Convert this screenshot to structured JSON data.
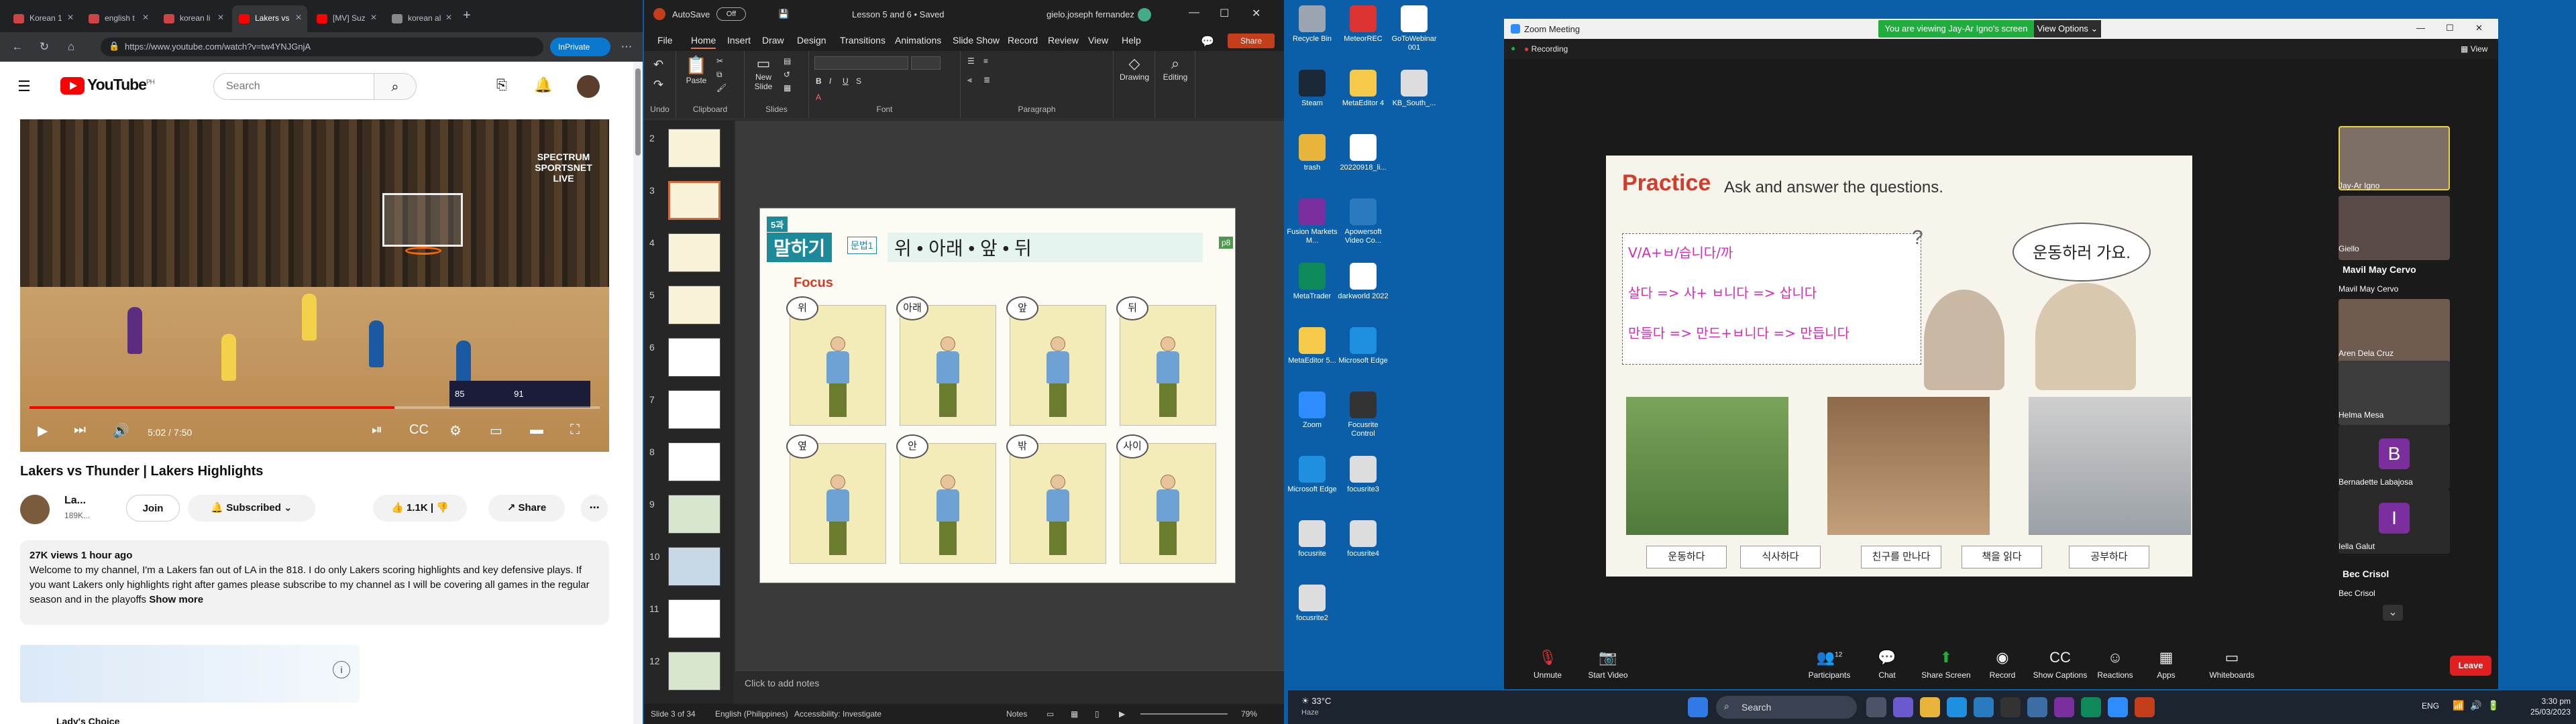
{
  "browser": {
    "tabs": [
      {
        "label": "Korean 1"
      },
      {
        "label": "english t"
      },
      {
        "label": "korean li"
      },
      {
        "label": "Lakers vs"
      },
      {
        "label": "[MV] Suz"
      },
      {
        "label": "korean al"
      }
    ],
    "url": "https://www.youtube.com/watch?v=tw4YNJGnjA",
    "inprivate": "InPrivate"
  },
  "youtube": {
    "logo": "YouTube",
    "region": "PH",
    "search_placeholder": "Search",
    "video": {
      "title": "Lakers vs Thunder | Lakers Highlights",
      "time": "5:02 / 7:50",
      "progress_percent": 64,
      "watermark": "SPECTRUM SPORTSNET LIVE",
      "score_left": "85",
      "score_right": "91"
    },
    "channel": {
      "name": "La...",
      "subs": "189K...",
      "join": "Join",
      "subscribed": "Subscribed",
      "likes": "1.1K",
      "share": "Share"
    },
    "description": {
      "meta": "27K views  1 hour ago",
      "text": "Welcome to my channel, I'm a Lakers fan out of LA in the 818. I do only Lakers scoring highlights and key defensive plays. If you want Lakers only highlights right after games please subscribe to my channel as I will be covering all games in the regular season and in the playoffs",
      "show_more": "Show more"
    },
    "ad_partial_title": "Lady's Choice"
  },
  "ppt": {
    "autosave": "AutoSave",
    "autosave_state": "Off",
    "doc_title": "Lesson 5 and 6 • Saved",
    "user": "gielo.joseph fernandez",
    "menu": [
      "File",
      "Home",
      "Insert",
      "Draw",
      "Design",
      "Transitions",
      "Animations",
      "Slide Show",
      "Record",
      "Review",
      "View",
      "Help"
    ],
    "share": "Share",
    "ribbon_groups": [
      {
        "label": "Undo"
      },
      {
        "label": "Clipboard"
      },
      {
        "label": "Slides"
      },
      {
        "label": "Font"
      },
      {
        "label": "Paragraph"
      },
      {
        "label": "Drawing"
      },
      {
        "label": "Editing"
      }
    ],
    "buttons": {
      "paste": "Paste",
      "new_slide": "New Slide",
      "drawing": "Drawing",
      "editing": "Editing"
    },
    "thumb_numbers": [
      "2",
      "3",
      "4",
      "5",
      "6",
      "7",
      "8",
      "9",
      "10",
      "11",
      "12"
    ],
    "slide": {
      "lesson": "5과",
      "heading": "말하기",
      "grammar_tag": "문법1",
      "topic": "위 • 아래 • 앞 • 뒤",
      "page": "p8",
      "focus": "Focus",
      "bubbles": [
        "위",
        "아래",
        "앞",
        "뒤",
        "옆",
        "안",
        "밖",
        "사이"
      ]
    },
    "notes_placeholder": "Click to add notes",
    "status": {
      "slide": "Slide 3 of 34",
      "language": "English (Philippines)",
      "accessibility": "Accessibility: Investigate",
      "notes": "Notes",
      "zoom": "79%"
    }
  },
  "desktop_icons": [
    {
      "label": "Recycle Bin"
    },
    {
      "label": "MeteorREC"
    },
    {
      "label": "GoToWebinar 001"
    },
    {
      "label": "Steam"
    },
    {
      "label": "MetaEditor 4"
    },
    {
      "label": "KB_South_..."
    },
    {
      "label": "trash"
    },
    {
      "label": "20220918_li..."
    },
    {
      "label": "Fusion Markets M..."
    },
    {
      "label": "Apowersoft Video Co..."
    },
    {
      "label": "MetaTrader"
    },
    {
      "label": "darkworld 2022"
    },
    {
      "label": "MetaEditor 5..."
    },
    {
      "label": "Microsoft Edge"
    },
    {
      "label": "Zoom"
    },
    {
      "label": "Focusrite Control"
    },
    {
      "label": "Microsoft Edge"
    },
    {
      "label": "focusrite3"
    },
    {
      "label": "focusrite"
    },
    {
      "label": "focusrite4"
    },
    {
      "label": "focusrite2"
    }
  ],
  "zoom": {
    "title": "Zoom Meeting",
    "banner": "You are viewing Jay-Ar Igno's screen",
    "view_options": "View Options",
    "recording": "Recording",
    "view": "View",
    "shared": {
      "practice": "Practice",
      "practice_sub": "Ask and answer the questions.",
      "lines": [
        "V/A+ㅂ/습니다/까",
        "살다 => 사+ ㅂ니다 => 삽니다",
        "만들다 => 만드+ㅂ니다 => 만듭니다"
      ],
      "speech": "운동하러 가요.",
      "question_mark": "?",
      "labels": [
        "운동하다",
        "식사하다",
        "친구를 만나다",
        "책을 읽다",
        "공부하다"
      ]
    },
    "participants": [
      {
        "name": "Jay-Ar Igno"
      },
      {
        "name": "Giello"
      },
      {
        "name": "Mavil May Cervo",
        "label_only": true
      },
      {
        "name": "Mavil May Cervo"
      },
      {
        "name": "Aren Dela Cruz"
      },
      {
        "name": "Helma Mesa"
      },
      {
        "name": "Bernadette Labajosa",
        "initial": "B"
      },
      {
        "name": "Iella Galut",
        "initial": "I"
      },
      {
        "name": "Bec Crisol",
        "label_only": true
      },
      {
        "name": "Bec Crisol"
      }
    ],
    "toolbar": [
      {
        "label": "Unmute"
      },
      {
        "label": "Start Video"
      },
      {
        "label": "Participants"
      },
      {
        "label": "Chat"
      },
      {
        "label": "Share Screen"
      },
      {
        "label": "Record"
      },
      {
        "label": "Show Captions"
      },
      {
        "label": "Reactions"
      },
      {
        "label": "Apps"
      },
      {
        "label": "Whiteboards"
      }
    ],
    "participants_count": "12",
    "leave": "Leave"
  },
  "taskbar": {
    "weather_temp": "33°C",
    "weather_desc": "Haze",
    "search": "Search",
    "lang": "ENG",
    "time": "3:30 pm",
    "date": "25/03/2023"
  }
}
